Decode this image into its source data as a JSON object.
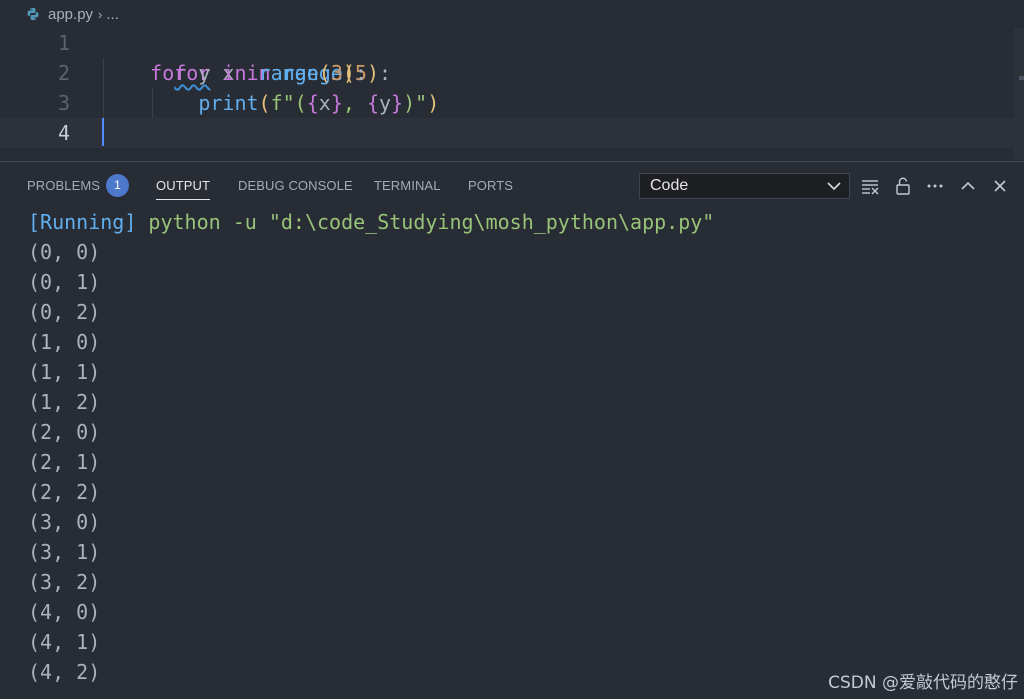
{
  "breadcrumb": {
    "file": "app.py",
    "separator": "›",
    "more": "..."
  },
  "editor": {
    "line_numbers": [
      "1",
      "2",
      "3",
      "4"
    ],
    "line1": {
      "kw_for": "for",
      "sp1": " x ",
      "kw_in": "in",
      "sp2": " ",
      "fn": "range",
      "open": "(",
      "num": "5",
      "close": ")",
      "colon": ":"
    },
    "line2": {
      "indent": "    ",
      "kw_for": "for",
      "sp1": " y ",
      "kw_in": "in",
      "sp2": " ",
      "fn": "range",
      "open": "(",
      "num": "3",
      "close": ")",
      "colon": ":"
    },
    "line3": {
      "indent": "        ",
      "fn": "print",
      "open": "(",
      "fstr_start": "f\"(",
      "b1o": "{",
      "x": "x",
      "b1c": "}",
      "mid": ", ",
      "b2o": "{",
      "y": "y",
      "b2c": "}",
      "fstr_end": ")\"",
      "close": ")"
    }
  },
  "panel": {
    "tabs": [
      {
        "label": "PROBLEMS"
      },
      {
        "label": "OUTPUT"
      },
      {
        "label": "DEBUG CONSOLE"
      },
      {
        "label": "TERMINAL"
      },
      {
        "label": "PORTS"
      }
    ],
    "problems_count": "1",
    "active_tab": "OUTPUT",
    "channel_select": "Code"
  },
  "output": {
    "running_tag": "[Running]",
    "command": " python -u \"d:\\code_Studying\\mosh_python\\app.py\"",
    "lines": [
      "(0, 0)",
      "(0, 1)",
      "(0, 2)",
      "(1, 0)",
      "(1, 1)",
      "(1, 2)",
      "(2, 0)",
      "(2, 1)",
      "(2, 2)",
      "(3, 0)",
      "(3, 1)",
      "(3, 2)",
      "(4, 0)",
      "(4, 1)",
      "(4, 2)"
    ]
  },
  "watermark": "CSDN @爱敲代码的憨仔",
  "colors": {
    "background": "#282c34",
    "keyword": "#c678dd",
    "function": "#61afef",
    "number": "#d19a66",
    "string": "#98c379",
    "badge": "#4d78cc"
  }
}
